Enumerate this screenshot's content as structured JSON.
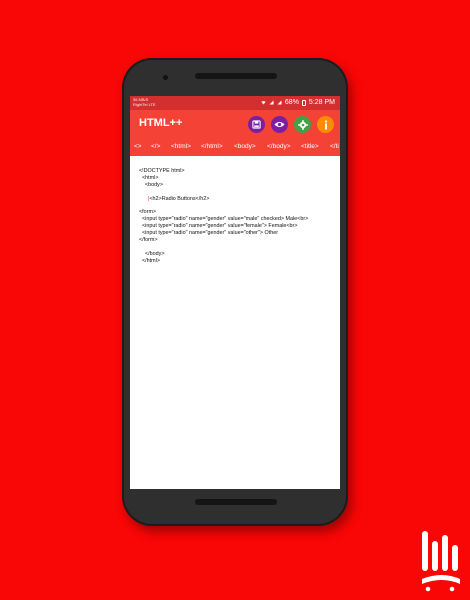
{
  "status_bar": {
    "carrier_line1": "36 MB/S",
    "carrier_line2": "RightTel  LTE",
    "battery": "68%",
    "time": "5:28 PM"
  },
  "toolbar": {
    "title": "HTML++",
    "save_icon": "save-icon",
    "preview_icon": "eye-icon",
    "settings_icon": "gear-icon",
    "info_icon": "info-icon",
    "colors": {
      "save": "#7b1fa2",
      "preview": "#7b1fa2",
      "settings": "#43a047",
      "info": "#fb8c00"
    }
  },
  "tabs": [
    "<>",
    "</>",
    "<html>",
    "</html>",
    "<body>",
    "</body>",
    "<title>",
    "</ti"
  ],
  "editor": {
    "lines": [
      "<!DOCTYPE html>",
      "  <html>",
      "    <body>",
      "",
      "      <h2>Radio Buttons</h2>",
      "",
      "<form>",
      "  <input type=\"radio\" name=\"gender\" value=\"male\" checked> Male<br>",
      "  <input type=\"radio\" name=\"gender\" value=\"female\"> Female<br>",
      "  <input type=\"radio\" name=\"gender\" value=\"other\"> Other",
      "</form>",
      "",
      "    </body>",
      "  </html>"
    ]
  },
  "colors": {
    "background": "#f90606",
    "appbar": "#f44336",
    "statusbar": "#d32f2f"
  }
}
